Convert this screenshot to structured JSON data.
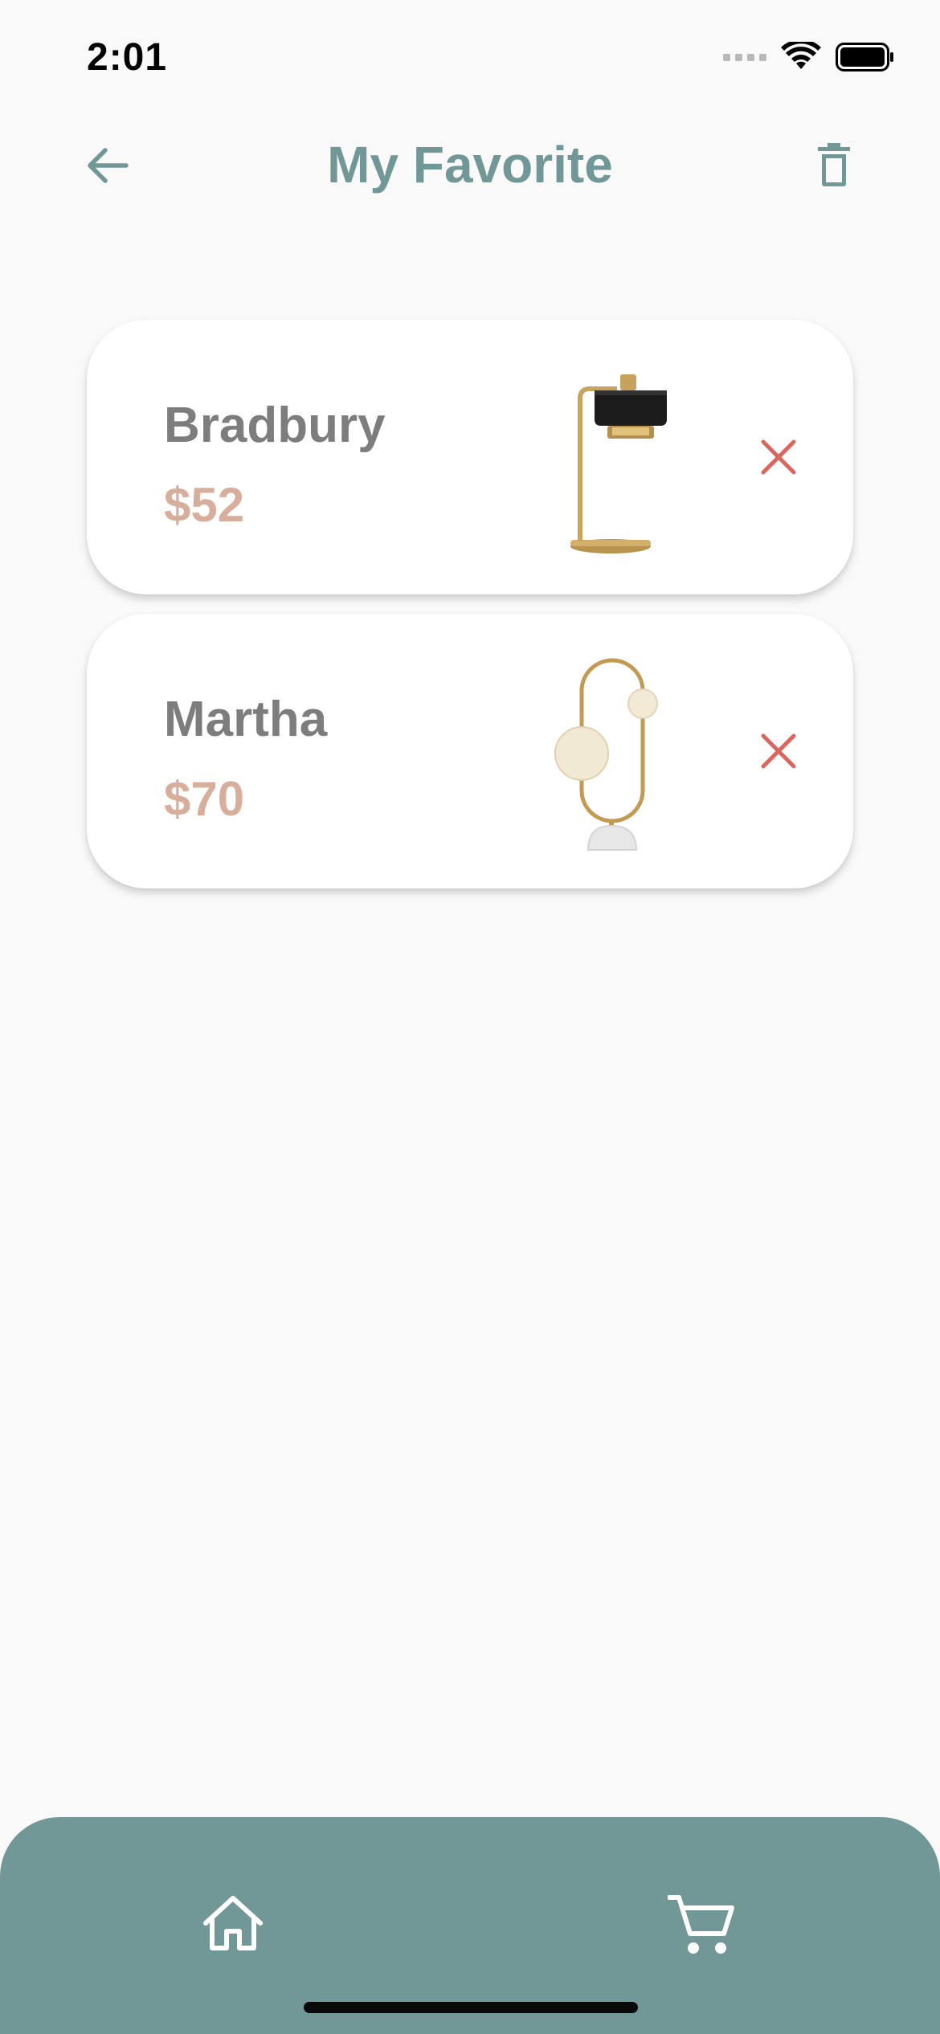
{
  "status_bar": {
    "time": "2:01",
    "icons": [
      "cellular-signal-icon",
      "wifi-icon",
      "battery-icon"
    ]
  },
  "header": {
    "title": "My Favorite",
    "back_icon": "arrow-left-icon",
    "delete_all_icon": "trash-icon"
  },
  "favorites": [
    {
      "name": "Bradbury",
      "price": "$52",
      "image": "black-shade-brass-desk-lamp",
      "remove_icon": "close-icon"
    },
    {
      "name": "Martha",
      "price": "$70",
      "image": "globe-brass-loop-table-lamp",
      "remove_icon": "close-icon"
    }
  ],
  "bottom_nav": {
    "items": [
      {
        "icon": "home-icon"
      },
      {
        "icon": "cart-icon"
      }
    ]
  },
  "colors": {
    "accent": "#729797",
    "background": "#f9f9f9",
    "card": "#ffffff",
    "name_text": "#7d7d7d",
    "price_text": "#d7ad9c",
    "remove_icon": "#d9665f"
  }
}
